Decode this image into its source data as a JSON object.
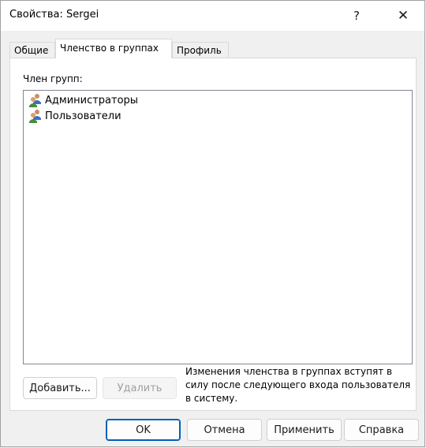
{
  "window": {
    "title": "Свойства: Sergei",
    "help_glyph": "?",
    "close_glyph": "✕"
  },
  "tabs": [
    {
      "label": "Общие",
      "active": false
    },
    {
      "label": "Членство в группах",
      "active": true
    },
    {
      "label": "Профиль",
      "active": false
    }
  ],
  "panel": {
    "list_label": "Член групп:",
    "groups": [
      {
        "name": "Администраторы",
        "icon": "group-icon"
      },
      {
        "name": "Пользователи",
        "icon": "group-icon"
      }
    ],
    "add_label": "Добавить...",
    "remove_label": "Удалить",
    "note": "Изменения членства в группах вступят в силу после следующего входа пользователя в систему."
  },
  "footer": {
    "ok_label": "OK",
    "cancel_label": "Отмена",
    "apply_label": "Применить",
    "help_label": "Справка"
  },
  "colors": {
    "accent": "#005fb8",
    "disabled_text": "#a0a0a0"
  }
}
